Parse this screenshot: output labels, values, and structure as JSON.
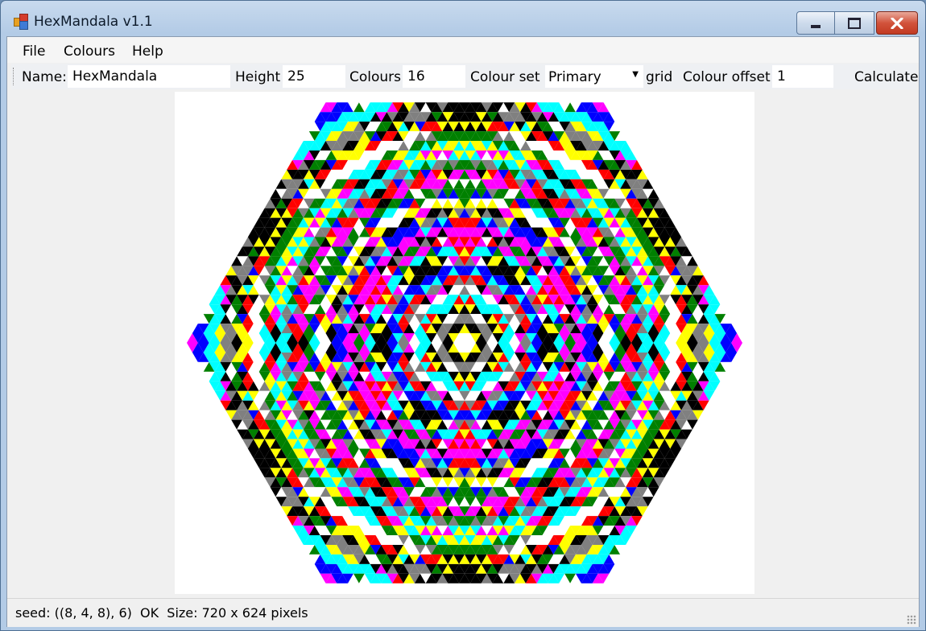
{
  "window": {
    "title": "HexMandala v1.1"
  },
  "menu": {
    "file": "File",
    "colours": "Colours",
    "help": "Help"
  },
  "toolbar": {
    "name_label": "Name:",
    "name_value": "HexMandala",
    "height_label": "Height",
    "height_value": "25",
    "colours_label": "Colours",
    "colours_value": "16",
    "colour_set_label": "Colour set",
    "colour_set_value": "Primary",
    "grid_label": "grid",
    "colour_offset_label": "Colour offset",
    "colour_offset_value": "1",
    "calculate_label": "Calculate"
  },
  "mandala": {
    "rows": 25,
    "palette": [
      "#000000",
      "#ff00ff",
      "#ffff00",
      "#ff0000",
      "#00ffff",
      "#0000ff",
      "#008000",
      "#808080",
      "#ffffff"
    ]
  },
  "status": {
    "text": "seed: ((8, 4, 8), 6)  OK  Size: 720 x 624 pixels"
  }
}
